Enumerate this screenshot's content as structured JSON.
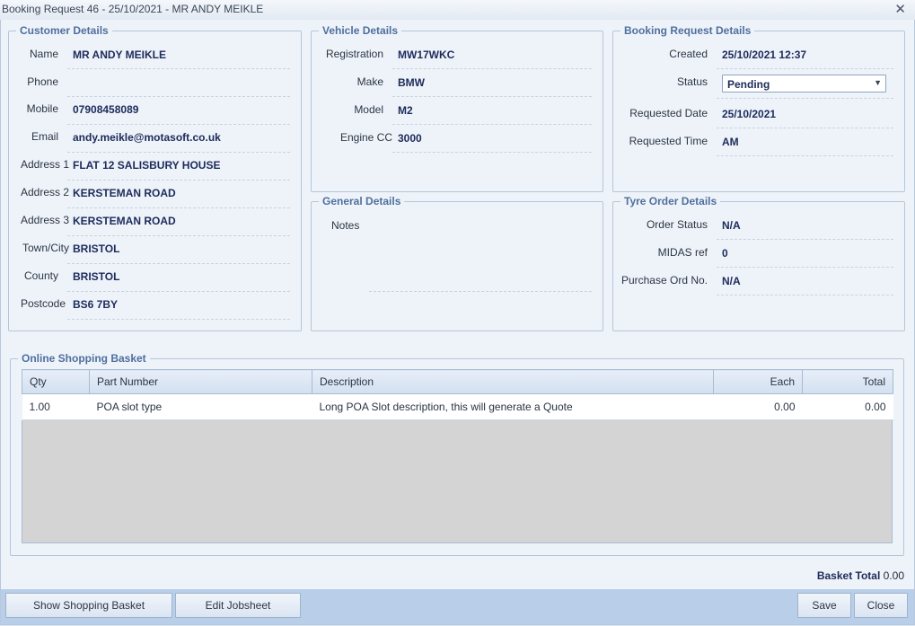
{
  "window": {
    "title": "Booking Request 46 - 25/10/2021 - MR ANDY MEIKLE",
    "close_glyph": "✕"
  },
  "customer": {
    "legend": "Customer Details",
    "fields": [
      {
        "label": "Name",
        "value": "MR ANDY MEIKLE"
      },
      {
        "label": "Phone",
        "value": ""
      },
      {
        "label": "Mobile",
        "value": "07908458089"
      },
      {
        "label": "Email",
        "value": "andy.meikle@motasoft.co.uk"
      },
      {
        "label": "Address 1",
        "value": "FLAT 12 SALISBURY HOUSE"
      },
      {
        "label": "Address 2",
        "value": "KERSTEMAN ROAD"
      },
      {
        "label": "Address 3",
        "value": "KERSTEMAN ROAD"
      },
      {
        "label": "Town/City",
        "value": "BRISTOL"
      },
      {
        "label": "County",
        "value": "BRISTOL"
      },
      {
        "label": "Postcode",
        "value": "BS6 7BY"
      }
    ]
  },
  "vehicle": {
    "legend": "Vehicle Details",
    "fields": [
      {
        "label": "Registration",
        "value": "MW17WKC"
      },
      {
        "label": "Make",
        "value": "BMW"
      },
      {
        "label": "Model",
        "value": "M2"
      },
      {
        "label": "Engine CC",
        "value": "3000"
      }
    ]
  },
  "general": {
    "legend": "General Details",
    "notes_label": "Notes",
    "notes_value": ""
  },
  "booking": {
    "legend": "Booking Request Details",
    "created_label": "Created",
    "created_value": "25/10/2021 12:37",
    "status_label": "Status",
    "status_value": "Pending",
    "req_date_label": "Requested Date",
    "req_date_value": "25/10/2021",
    "req_time_label": "Requested Time",
    "req_time_value": "AM"
  },
  "tyre": {
    "legend": "Tyre Order Details",
    "fields": [
      {
        "label": "Order Status",
        "value": "N/A"
      },
      {
        "label": "MIDAS ref",
        "value": "0"
      },
      {
        "label": "Purchase Ord No.",
        "value": "N/A"
      }
    ]
  },
  "basket": {
    "legend": "Online Shopping Basket",
    "columns": [
      "Qty",
      "Part Number",
      "Description",
      "Each",
      "Total"
    ],
    "rows": [
      {
        "qty": "1.00",
        "part": "POA slot type",
        "desc": "Long POA Slot description, this will generate a Quote",
        "each": "0.00",
        "total": "0.00"
      }
    ],
    "total_label": "Basket Total",
    "total_value": "0.00"
  },
  "buttons": {
    "show_basket": "Show Shopping Basket",
    "edit_jobsheet": "Edit Jobsheet",
    "save": "Save",
    "close": "Close"
  }
}
